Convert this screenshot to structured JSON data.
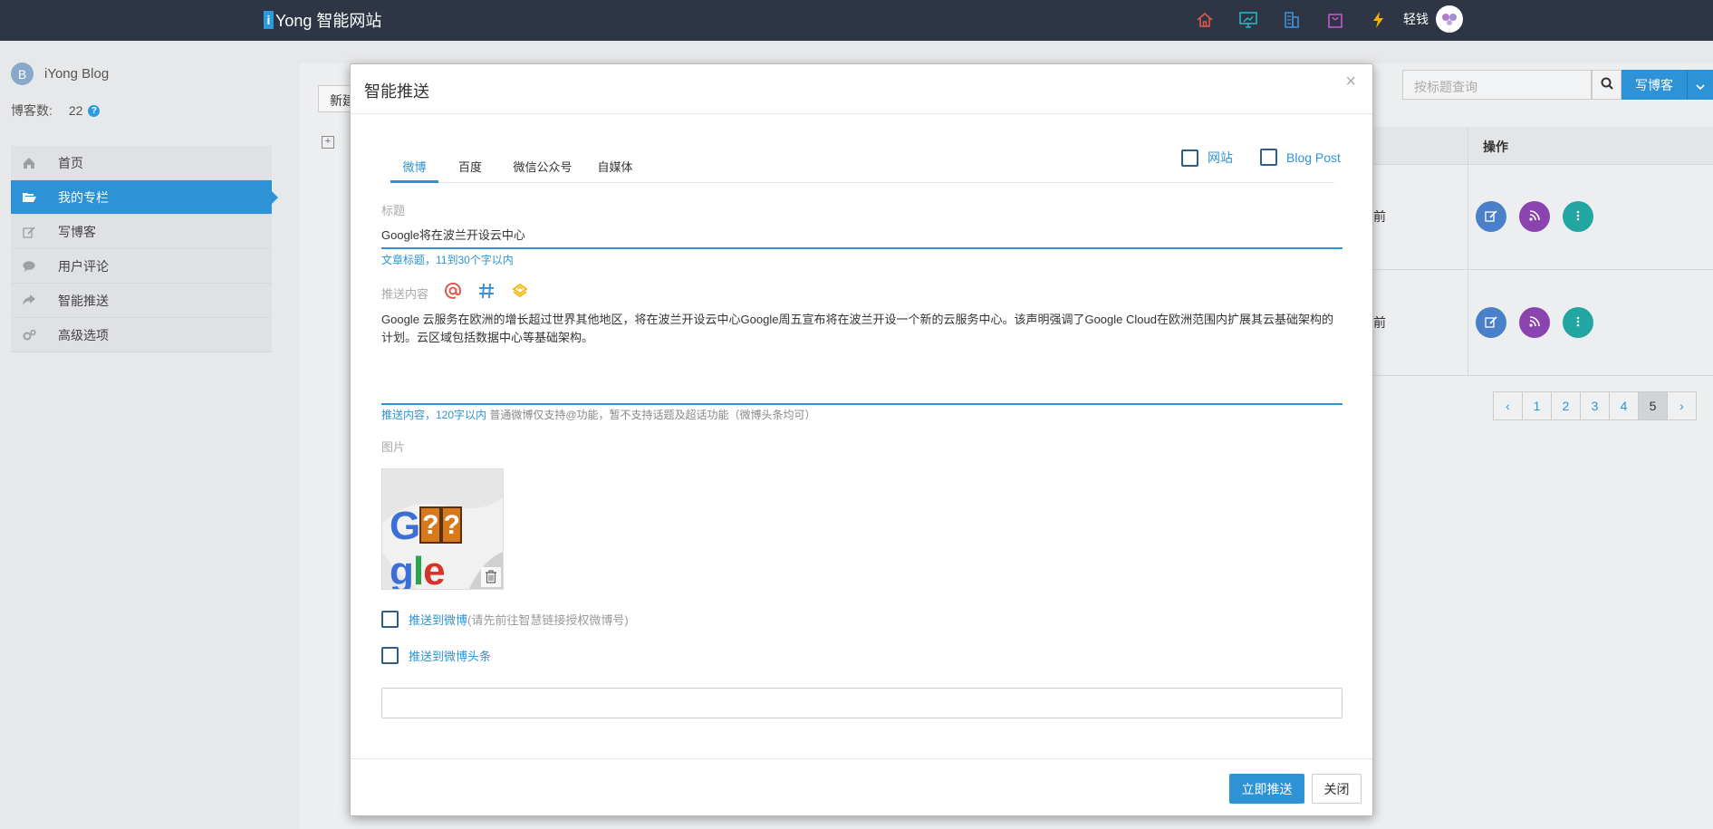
{
  "topbar": {
    "brand_i": "i",
    "brand_text": "Yong 智能网站",
    "username": "轻钱",
    "icons": [
      "home-icon",
      "monitor-icon",
      "building-icon",
      "bag-icon",
      "lightning-icon"
    ],
    "icon_colors": {
      "home": "#e0584a",
      "monitor": "#2bb3c7",
      "building": "#3f8fd6",
      "bag": "#c05ac9",
      "lightning": "#f5b400"
    }
  },
  "sidebar": {
    "blog_initial": "B",
    "blog_name": "iYong Blog",
    "count_label": "博客数:",
    "count_value": "22",
    "help_mark": "?",
    "items": [
      {
        "label": "首页",
        "icon": "home-icon"
      },
      {
        "label": "我的专栏",
        "icon": "folder-open-icon",
        "active": true
      },
      {
        "label": "写博客",
        "icon": "edit-icon"
      },
      {
        "label": "用户评论",
        "icon": "comment-icon"
      },
      {
        "label": "智能推送",
        "icon": "share-icon"
      },
      {
        "label": "高级选项",
        "icon": "cogs-icon"
      }
    ]
  },
  "background": {
    "new_button": "新建",
    "plus_mark": "+",
    "search_placeholder": "按标题查询",
    "write_button": "写博客",
    "table_header_ops": "操作",
    "rows": [
      {
        "ago": "前"
      },
      {
        "ago": "前"
      }
    ],
    "pages": [
      "‹",
      "1",
      "2",
      "3",
      "4",
      "5",
      "›"
    ],
    "active_page": "5"
  },
  "modal": {
    "title": "智能推送",
    "close": "×",
    "tabs": [
      {
        "label": "微博",
        "active": true
      },
      {
        "label": "百度"
      },
      {
        "label": "微信公众号"
      },
      {
        "label": "自媒体"
      }
    ],
    "options": [
      {
        "label": "网站"
      },
      {
        "label": "Blog Post"
      }
    ],
    "title_label": "标题",
    "title_value": "Google将在波兰开设云中心",
    "title_help": "文章标题，11到30个字以内",
    "content_label": "推送内容",
    "content_value": "Google 云服务在欧洲的增长超过世界其他地区，将在波兰开设云中心Google周五宣布将在波兰开设一个新的云服务中心。该声明强调了Google Cloud在欧洲范围内扩展其云基础架构的计划。云区域包括数据中心等基础架构。",
    "content_help_main": "推送内容，120字以内",
    "content_help_muted": "普通微博仅支持@功能，暂不支持话题及超话功能（微博头条均可）",
    "image_label": "图片",
    "image_text": "Google",
    "push_weibo_label": "推送到微博",
    "push_weibo_note": "(请先前往智慧链接授权微博号)",
    "push_toutiao_label": "推送到微博头条",
    "push_button": "立即推送",
    "close_button": "关闭"
  },
  "colors": {
    "accent": "#2d93d6",
    "topbar": "#2e3645"
  }
}
